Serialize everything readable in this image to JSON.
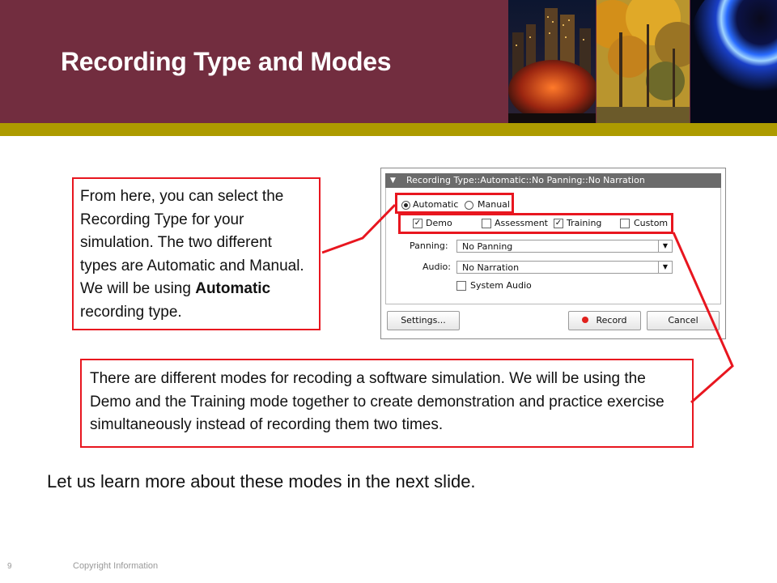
{
  "slide": {
    "title": "Recording Type and Modes",
    "page_number": "9",
    "copyright": "Copyright Information",
    "bottom_text": "Let us learn more about these modes in the next slide."
  },
  "callout1": {
    "text_before": "From here, you can select the Recording Type for your simulation. The two different types are Automatic and Manual. We will be using ",
    "bold": "Automatic",
    "text_after": " recording type."
  },
  "callout2": {
    "text": "There are different modes for recoding a software simulation. We will be using the Demo and the Training mode together to create demonstration and practice exercise simultaneously instead of recording  them two times."
  },
  "dialog": {
    "title": "Recording Type::Automatic::No Panning::No Narration",
    "type_options": [
      {
        "label": "Automatic",
        "selected": true
      },
      {
        "label": "Manual",
        "selected": false
      }
    ],
    "modes": [
      {
        "label": "Demo",
        "checked": true
      },
      {
        "label": "Assessment",
        "checked": false
      },
      {
        "label": "Training",
        "checked": true
      },
      {
        "label": "Custom",
        "checked": false
      }
    ],
    "panning_label": "Panning:",
    "panning_value": "No Panning",
    "audio_label": "Audio:",
    "audio_value": "No Narration",
    "system_audio_label": "System Audio",
    "settings_button": "Settings...",
    "record_button": "Record",
    "cancel_button": "Cancel"
  },
  "colors": {
    "header": "#722d3f",
    "gold_bar": "#ad9b00",
    "highlight": "#e8161f"
  }
}
